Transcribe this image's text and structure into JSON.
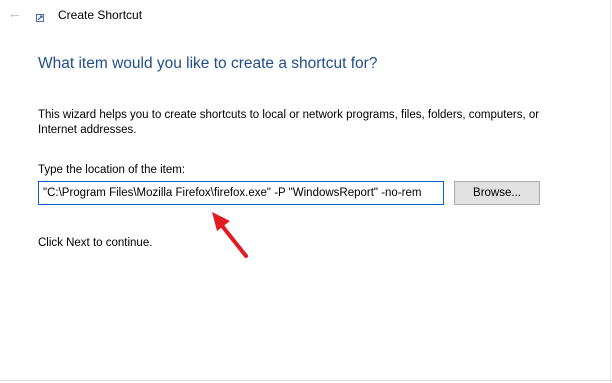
{
  "window": {
    "title": "Create Shortcut",
    "back_icon": "back-arrow-icon",
    "app_icon": "shortcut-icon"
  },
  "main": {
    "heading": "What item would you like to create a shortcut for?",
    "description": "This wizard helps you to create shortcuts to local or network programs, files, folders, computers, or Internet addresses.",
    "location_label": "Type the location of the item:",
    "location_value": "\"C:\\Program Files\\Mozilla Firefox\\firefox.exe\" -P \"WindowsReport\" -no-rem",
    "browse_label": "Browse...",
    "next_hint": "Click Next to continue."
  },
  "annotation": {
    "icon": "red-arrow-icon",
    "color": "#e11b22"
  },
  "colors": {
    "heading": "#1f4e8c",
    "input_border": "#0a64c8",
    "button_bg": "#e1e1e1"
  }
}
